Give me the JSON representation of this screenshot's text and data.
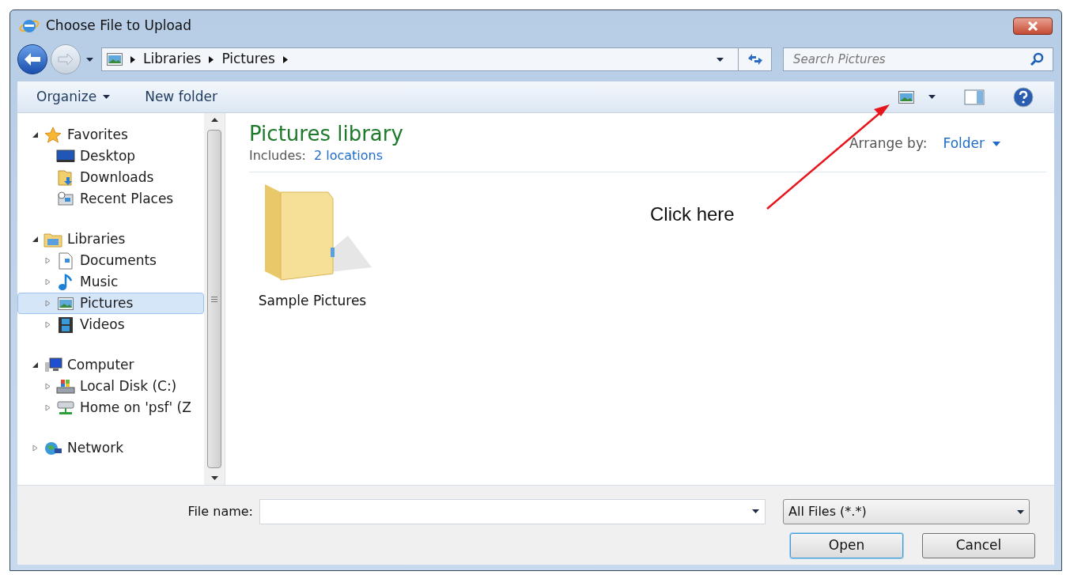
{
  "window": {
    "title": "Choose File to Upload"
  },
  "address_bar": {
    "breadcrumb": [
      "Libraries",
      "Pictures"
    ]
  },
  "search": {
    "placeholder": "Search Pictures"
  },
  "toolbar": {
    "buttons": [
      {
        "label": "Organize",
        "dropdown": true
      },
      {
        "label": "New folder",
        "dropdown": false
      }
    ]
  },
  "sidebar": {
    "sections": [
      {
        "label": "Favorites",
        "expanded": true,
        "selected": false,
        "children": [
          {
            "label": "Desktop",
            "selected": false
          },
          {
            "label": "Downloads",
            "selected": false
          },
          {
            "label": "Recent Places",
            "selected": false
          }
        ]
      },
      {
        "label": "Libraries",
        "expanded": true,
        "selected": false,
        "children": [
          {
            "label": "Documents",
            "selected": false,
            "expanded": false
          },
          {
            "label": "Music",
            "selected": false,
            "expanded": false
          },
          {
            "label": "Pictures",
            "selected": true,
            "expanded": false
          },
          {
            "label": "Videos",
            "selected": false,
            "expanded": false
          }
        ]
      },
      {
        "label": "Computer",
        "expanded": true,
        "selected": false,
        "children": [
          {
            "label": "Local Disk (C:)",
            "selected": false,
            "expanded": false
          },
          {
            "label": "Home on 'psf' (Z",
            "selected": false,
            "expanded": false
          }
        ]
      },
      {
        "label": "Network",
        "expanded": false,
        "selected": false
      }
    ]
  },
  "library": {
    "title": "Pictures library",
    "includes_label": "Includes:",
    "includes_link": "2 locations",
    "arrange_label": "Arrange by:",
    "arrange_value": "Folder"
  },
  "items": [
    {
      "label": "Sample Pictures",
      "kind": "folder"
    }
  ],
  "file_name": {
    "label": "File name:"
  },
  "filter": {
    "value": "All Files (*.*)"
  },
  "buttons": [
    {
      "label": "Open",
      "default": true
    },
    {
      "label": "Cancel",
      "default": false
    }
  ],
  "annotation": {
    "text": "Click here"
  }
}
